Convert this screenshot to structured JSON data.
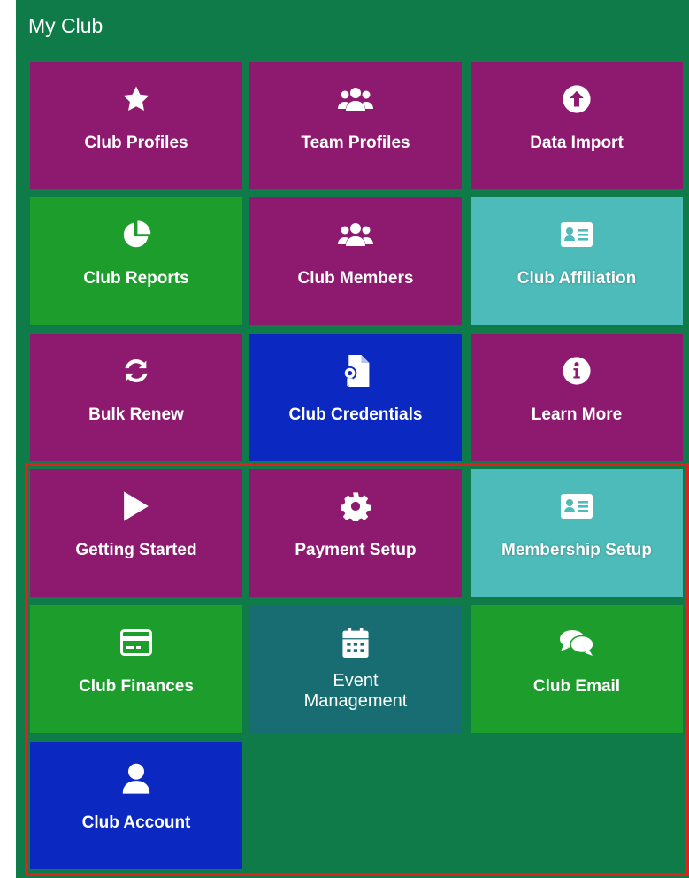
{
  "panel": {
    "title": "My Club",
    "background": "#0f7b48"
  },
  "highlight_color": "#e0201d",
  "tiles": [
    {
      "label": "Club Profiles",
      "icon": "star-icon",
      "color": "#8d1a6f"
    },
    {
      "label": "Team Profiles",
      "icon": "users-icon",
      "color": "#8d1a6f"
    },
    {
      "label": "Data Import",
      "icon": "upload-circle-icon",
      "color": "#8d1a6f"
    },
    {
      "label": "Club Reports",
      "icon": "pie-chart-icon",
      "color": "#1d9d2c"
    },
    {
      "label": "Club Members",
      "icon": "users-icon",
      "color": "#8d1a6f"
    },
    {
      "label": "Club Affiliation",
      "icon": "id-card-icon",
      "color": "#4dbbb9"
    },
    {
      "label": "Bulk Renew",
      "icon": "sync-icon",
      "color": "#8d1a6f"
    },
    {
      "label": "Club Credentials",
      "icon": "certificate-file-icon",
      "color": "#0b28c1"
    },
    {
      "label": "Learn More",
      "icon": "info-circle-icon",
      "color": "#8d1a6f"
    },
    {
      "label": "Getting Started",
      "icon": "play-icon",
      "color": "#8d1a6f"
    },
    {
      "label": "Payment Setup",
      "icon": "gear-icon",
      "color": "#8d1a6f"
    },
    {
      "label": "Membership Setup",
      "icon": "id-card-icon",
      "color": "#4dbbb9"
    },
    {
      "label": "Club Finances",
      "icon": "credit-card-icon",
      "color": "#1d9d2c"
    },
    {
      "label": "Event Management",
      "icon": "calendar-icon",
      "color": "#176d72"
    },
    {
      "label": "Club Email",
      "icon": "chat-bubbles-icon",
      "color": "#1d9d2c"
    },
    {
      "label": "Club Account",
      "icon": "user-icon",
      "color": "#0b28c1"
    }
  ]
}
